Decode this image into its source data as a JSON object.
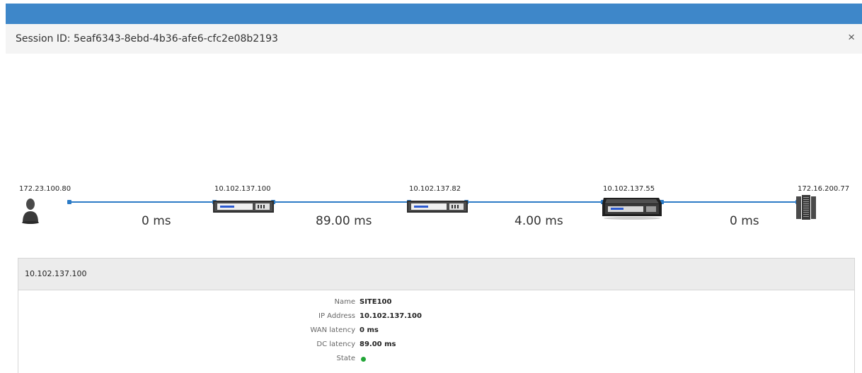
{
  "window": {
    "titlebar_color": "#3e87c9"
  },
  "session": {
    "title": "Session ID: 5eaf6343-8ebd-4b36-afe6-cfc2e08b2193",
    "close_label": "×"
  },
  "path": {
    "nodes": [
      {
        "ip": "172.23.100.80",
        "icon": "user-icon"
      },
      {
        "ip": "10.102.137.100",
        "icon": "appliance-icon"
      },
      {
        "ip": "10.102.137.82",
        "icon": "appliance-icon"
      },
      {
        "ip": "10.102.137.55",
        "icon": "appliance-large-icon"
      },
      {
        "ip": "172.16.200.77",
        "icon": "server-icon"
      }
    ],
    "links": [
      {
        "latency": "0 ms"
      },
      {
        "latency": "89.00 ms"
      },
      {
        "latency": "4.00 ms"
      },
      {
        "latency": "0 ms"
      }
    ],
    "link_color": "#2c7bc6"
  },
  "detail": {
    "header": "10.102.137.100",
    "rows": [
      {
        "label": "Name",
        "value": "SITE100"
      },
      {
        "label": "IP Address",
        "value": "10.102.137.100"
      },
      {
        "label": "WAN latency",
        "value": "0 ms"
      },
      {
        "label": "DC latency",
        "value": "89.00 ms"
      },
      {
        "label": "State",
        "value": ""
      }
    ],
    "state_color": "#22a537"
  }
}
